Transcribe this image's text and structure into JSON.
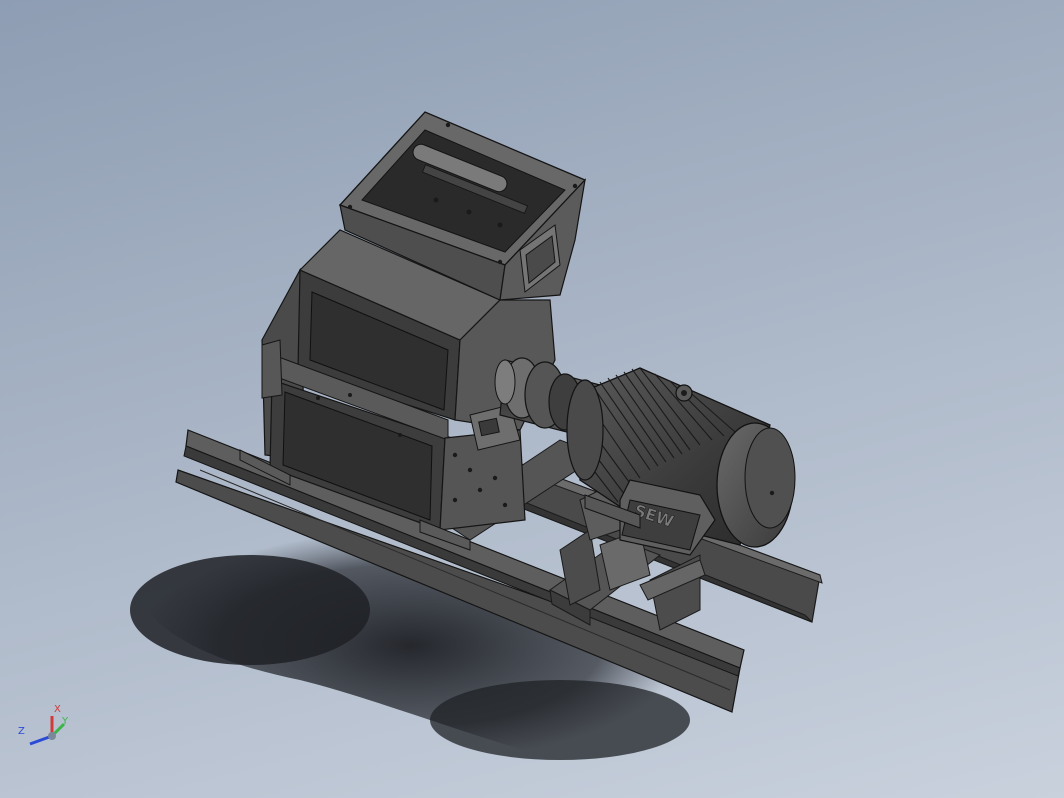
{
  "model": {
    "motor_label": "SEW"
  },
  "triad": {
    "x_label": "X",
    "y_label": "Y",
    "z_label": "Z",
    "x_color": "#d23a3a",
    "y_color": "#3cb44a",
    "z_color": "#2b4bd6"
  }
}
